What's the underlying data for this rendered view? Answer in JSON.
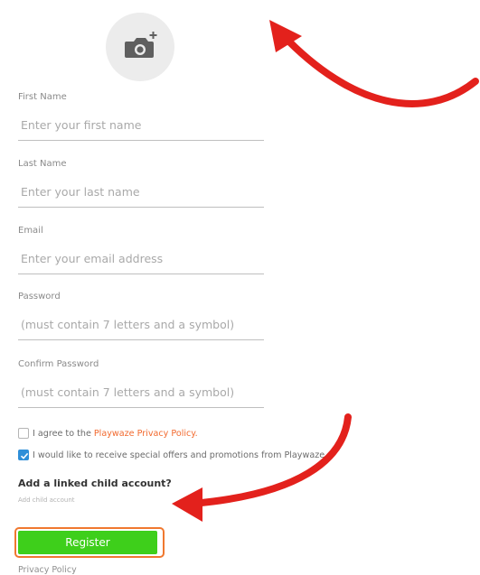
{
  "avatar": {
    "icon": "camera-plus-icon"
  },
  "form": {
    "fields": [
      {
        "label": "First Name",
        "placeholder": "Enter your first name"
      },
      {
        "label": "Last Name",
        "placeholder": "Enter your last name"
      },
      {
        "label": "Email",
        "placeholder": "Enter your email address"
      },
      {
        "label": "Password",
        "placeholder": "(must contain 7 letters and a symbol)"
      },
      {
        "label": "Confirm Password",
        "placeholder": "(must contain 7 letters and a symbol)"
      }
    ],
    "agree_prefix": "I agree to the",
    "agree_link": "Playwaze Privacy Policy.",
    "agree_checked": false,
    "offers_text": "I would like to receive special offers and promotions from Playwaze",
    "offers_checked": true,
    "child_title": "Add a linked child account?",
    "child_link": "Add child account",
    "register_label": "Register",
    "privacy_label": "Privacy Policy"
  },
  "colors": {
    "register_green": "#3ecf1b",
    "highlight_orange": "#f0782f",
    "link_orange": "#f26a2f",
    "checkbox_blue": "#2f8fd8",
    "annotation_red": "#e3211c"
  }
}
